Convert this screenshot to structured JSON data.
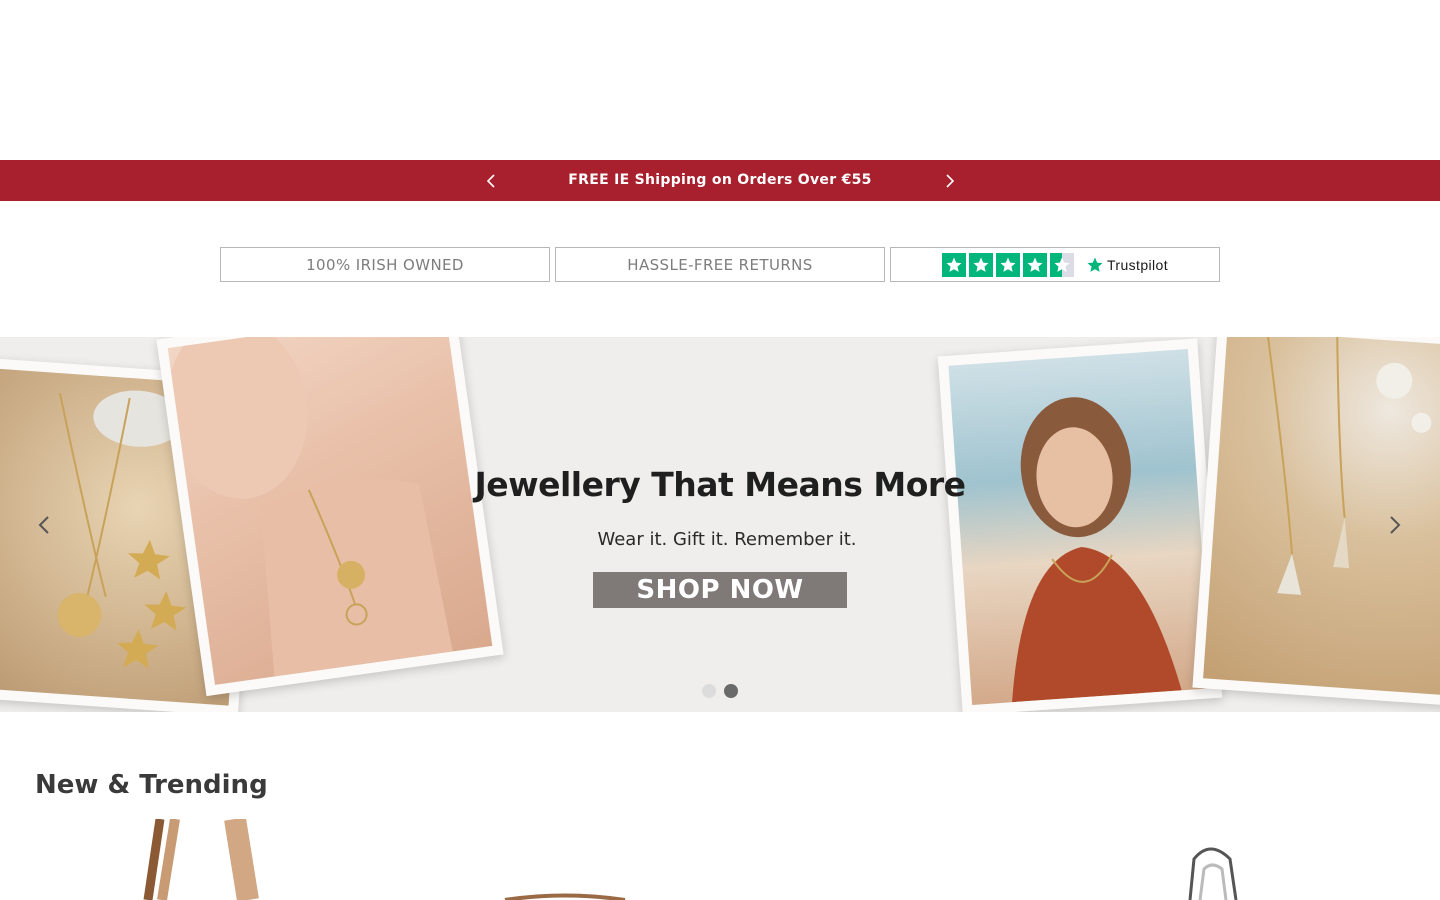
{
  "announcement": {
    "message": "FREE IE Shipping on Orders Over €55",
    "background": "#a8202d"
  },
  "usp": {
    "items": [
      "100% IRISH OWNED",
      "HASSLE-FREE RETURNS"
    ],
    "trustpilot": {
      "label": "Trustpilot",
      "stars": 4.5
    }
  },
  "hero": {
    "title": "Jewellery That Means More",
    "subtitle": "Wear it. Gift it. Remember it.",
    "cta": "SHOP NOW",
    "slides_total": 2,
    "active_slide": 2
  },
  "section": {
    "title": "New & Trending"
  },
  "colors": {
    "accent": "#a8202d",
    "cta": "#7f7977",
    "trustpilot": "#00b67a"
  }
}
